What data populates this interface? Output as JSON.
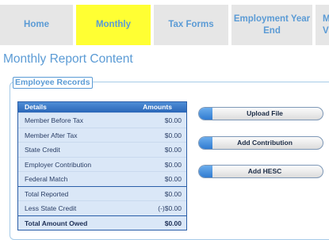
{
  "nav": {
    "tabs": [
      {
        "label": "Home"
      },
      {
        "label": "Monthly"
      },
      {
        "label": "Tax Forms"
      },
      {
        "label": "Employment Year End"
      },
      {
        "label": "M V"
      }
    ]
  },
  "page_title": "Monthly Report Content",
  "records": {
    "legend": "Employee Records",
    "header": {
      "details": "Details",
      "amounts": "Amounts"
    },
    "rows": [
      {
        "label": "Member Before Tax",
        "value": "$0.00"
      },
      {
        "label": "Member After Tax",
        "value": "$0.00"
      },
      {
        "label": "State Credit",
        "value": "$0.00"
      },
      {
        "label": "Employer Contribution",
        "value": "$0.00"
      },
      {
        "label": "Federal Match",
        "value": "$0.00"
      },
      {
        "label": "Total Reported",
        "value": "$0.00"
      },
      {
        "label": "Less State Credit",
        "value": "(-)$0.00"
      },
      {
        "label": "Total Amount Owed",
        "value": "$0.00"
      }
    ]
  },
  "buttons": {
    "upload": "Upload File",
    "add_contribution": "Add Contribution",
    "add_hesc": "Add HESC"
  },
  "colors": {
    "accent": "#5b9bd5",
    "highlight": "#ffff33",
    "table_header": "#2a66b8"
  }
}
